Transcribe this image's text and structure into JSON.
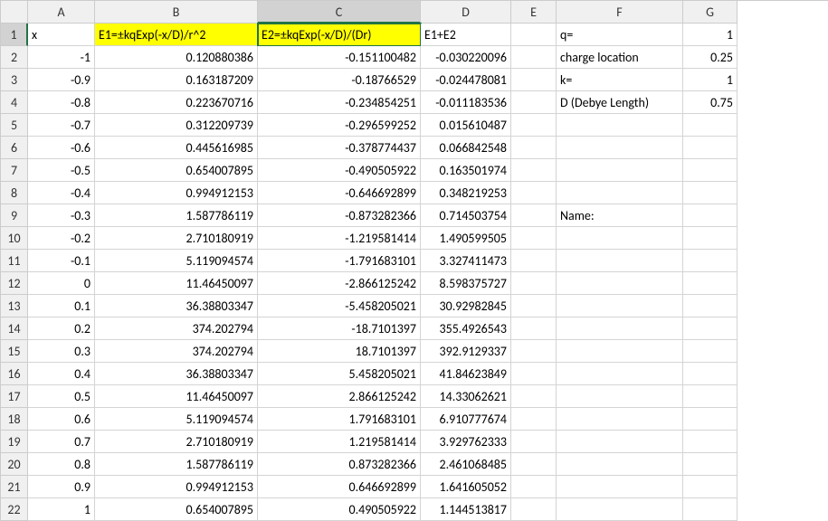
{
  "columns": [
    "A",
    "B",
    "C",
    "D",
    "E",
    "F",
    "G"
  ],
  "selectedCell": "C1",
  "headerRow": {
    "A": "x",
    "B": "E1=±kqExp(-x/D)/r^2",
    "C": "E2=±kqExp(-x/D)/(Dr)",
    "D": "E1+E2"
  },
  "params": [
    {
      "row": 1,
      "label": "q=",
      "value": "1"
    },
    {
      "row": 2,
      "label": "charge location",
      "value": "0.25"
    },
    {
      "row": 3,
      "label": "k=",
      "value": "1"
    },
    {
      "row": 4,
      "label": "D (Debye Length)",
      "value": "0.75"
    },
    {
      "row": 9,
      "label": "Name:",
      "value": ""
    }
  ],
  "chart_data": {
    "type": "table",
    "title": "Screened Coulomb / Debye field columns",
    "columns": [
      "x",
      "E1=±kqExp(-x/D)/r^2",
      "E2=±kqExp(-x/D)/(Dr)",
      "E1+E2"
    ],
    "rows": [
      {
        "x": "-1",
        "E1": "0.120880386",
        "E2": "-0.151100482",
        "sum": "-0.030220096"
      },
      {
        "x": "-0.9",
        "E1": "0.163187209",
        "E2": "-0.18766529",
        "sum": "-0.024478081"
      },
      {
        "x": "-0.8",
        "E1": "0.223670716",
        "E2": "-0.234854251",
        "sum": "-0.011183536"
      },
      {
        "x": "-0.7",
        "E1": "0.312209739",
        "E2": "-0.296599252",
        "sum": "0.015610487"
      },
      {
        "x": "-0.6",
        "E1": "0.445616985",
        "E2": "-0.378774437",
        "sum": "0.066842548"
      },
      {
        "x": "-0.5",
        "E1": "0.654007895",
        "E2": "-0.490505922",
        "sum": "0.163501974"
      },
      {
        "x": "-0.4",
        "E1": "0.994912153",
        "E2": "-0.646692899",
        "sum": "0.348219253"
      },
      {
        "x": "-0.3",
        "E1": "1.587786119",
        "E2": "-0.873282366",
        "sum": "0.714503754"
      },
      {
        "x": "-0.2",
        "E1": "2.710180919",
        "E2": "-1.219581414",
        "sum": "1.490599505"
      },
      {
        "x": "-0.1",
        "E1": "5.119094574",
        "E2": "-1.791683101",
        "sum": "3.327411473"
      },
      {
        "x": "0",
        "E1": "11.46450097",
        "E2": "-2.866125242",
        "sum": "8.598375727"
      },
      {
        "x": "0.1",
        "E1": "36.38803347",
        "E2": "-5.458205021",
        "sum": "30.92982845"
      },
      {
        "x": "0.2",
        "E1": "374.202794",
        "E2": "-18.7101397",
        "sum": "355.4926543"
      },
      {
        "x": "0.3",
        "E1": "374.202794",
        "E2": "18.7101397",
        "sum": "392.9129337"
      },
      {
        "x": "0.4",
        "E1": "36.38803347",
        "E2": "5.458205021",
        "sum": "41.84623849"
      },
      {
        "x": "0.5",
        "E1": "11.46450097",
        "E2": "2.866125242",
        "sum": "14.33062621"
      },
      {
        "x": "0.6",
        "E1": "5.119094574",
        "E2": "1.791683101",
        "sum": "6.910777674"
      },
      {
        "x": "0.7",
        "E1": "2.710180919",
        "E2": "1.219581414",
        "sum": "3.929762333"
      },
      {
        "x": "0.8",
        "E1": "1.587786119",
        "E2": "0.873282366",
        "sum": "2.461068485"
      },
      {
        "x": "0.9",
        "E1": "0.994912153",
        "E2": "0.646692899",
        "sum": "1.641605052"
      },
      {
        "x": "1",
        "E1": "0.654007895",
        "E2": "0.490505922",
        "sum": "1.144513817"
      }
    ]
  }
}
